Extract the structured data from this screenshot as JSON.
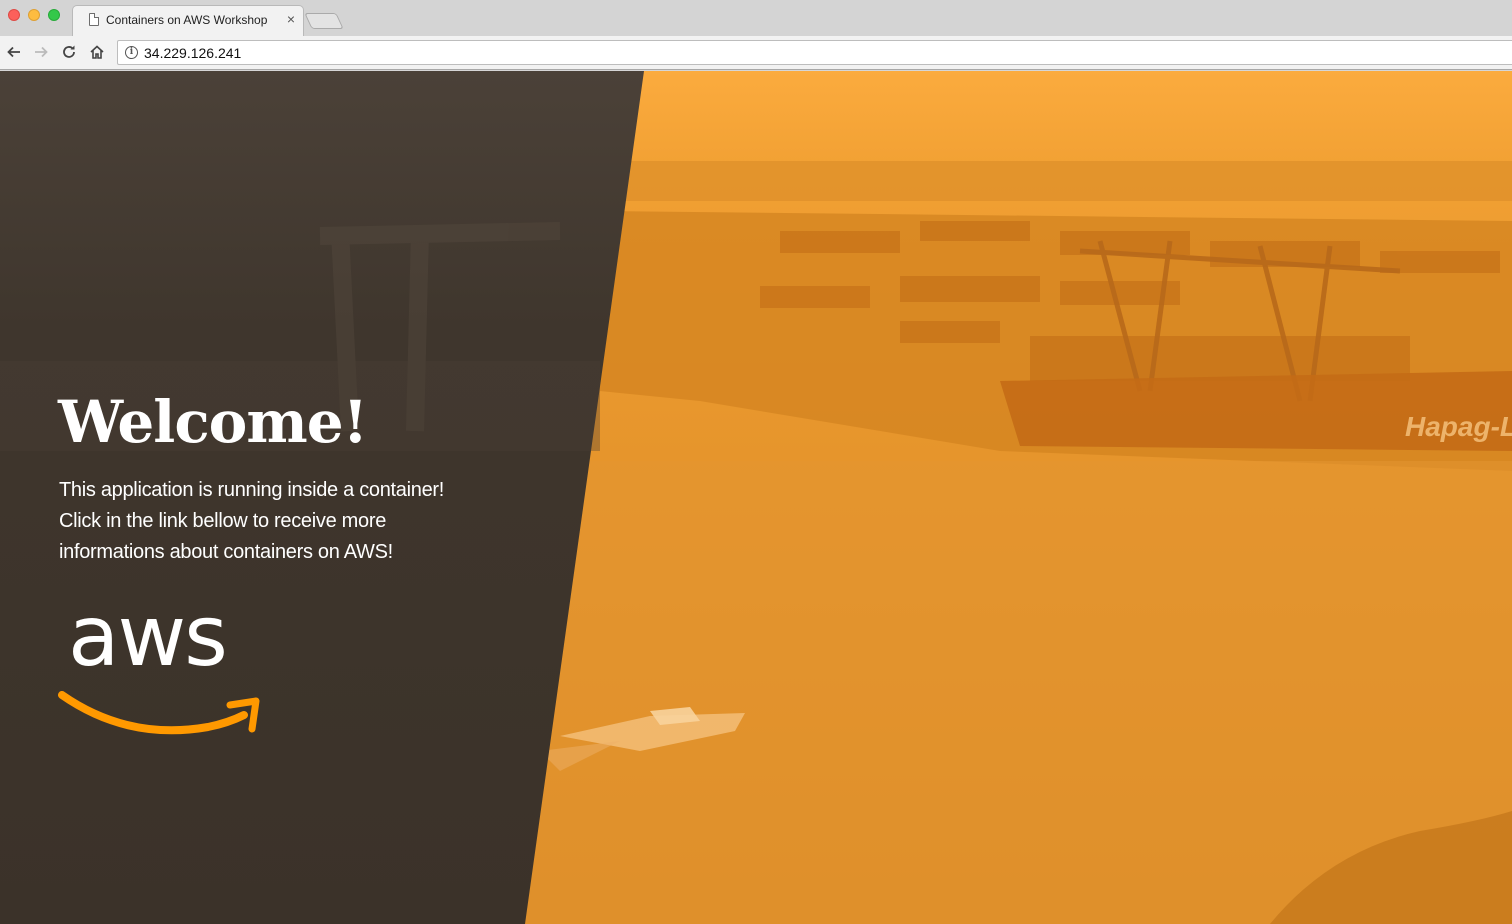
{
  "browser": {
    "tab_title": "Containers on AWS Workshop",
    "tab_close": "×",
    "url": "34.229.126.241",
    "info_icon_glyph": "i",
    "icons": [
      "back-arrow-icon",
      "forward-arrow-icon",
      "reload-icon",
      "home-icon",
      "info-icon",
      "page-icon",
      "close-icon"
    ]
  },
  "page": {
    "heading": "Welcome!",
    "lines": [
      "This application is running inside a container!",
      "Click in the link bellow to receive more",
      "informations about containers on AWS!"
    ],
    "logo_text": "aws",
    "colors": {
      "dark_panel": "#3f352c",
      "orange_overlay": "#f0a030",
      "aws_smile": "#ff9900"
    }
  }
}
